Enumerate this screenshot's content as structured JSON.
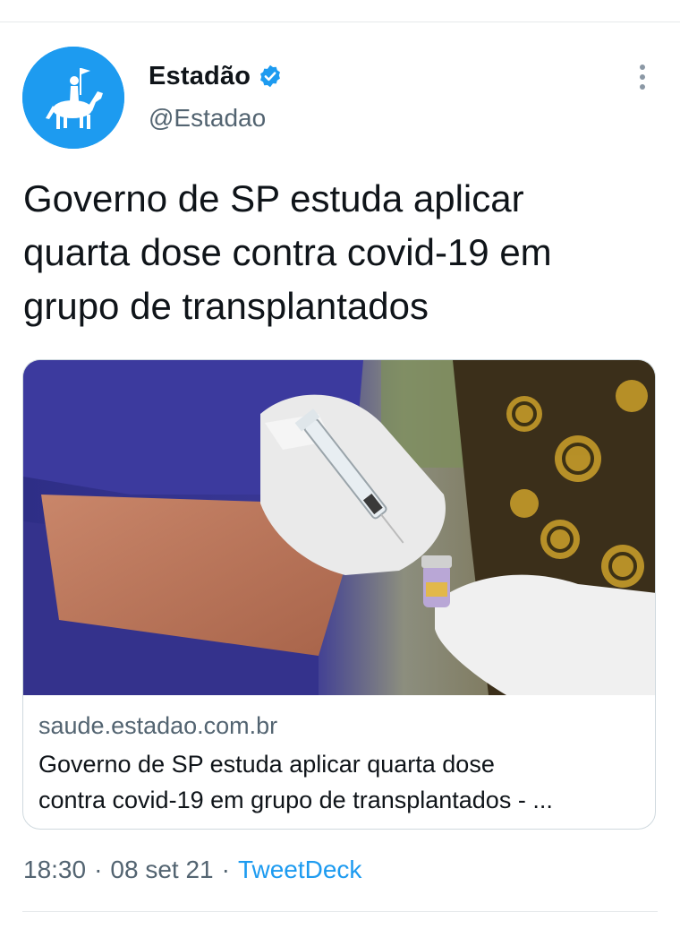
{
  "tweet": {
    "author": {
      "display_name": "Estadão",
      "handle": "@Estadao",
      "verified": true,
      "avatar_icon": "horse-rider-logo-icon",
      "avatar_color": "#1d9bf0"
    },
    "text_lines": [
      "Governo de SP estuda aplicar",
      "quarta dose contra covid-19 em",
      "grupo de transplantados"
    ],
    "link_card": {
      "image_icon": "vaccine-syringe-photo",
      "domain": "saude.estadao.com.br",
      "title_lines": [
        "Governo de SP estuda aplicar quarta dose",
        "contra covid-19 em grupo de transplantados - ..."
      ]
    },
    "meta": {
      "time": "18:30",
      "separator": "·",
      "date": "08 set 21",
      "source": "TweetDeck"
    }
  },
  "colors": {
    "accent": "#1d9bf0",
    "text_primary": "#0f1419",
    "text_secondary": "#536471",
    "border": "#cfd9de"
  },
  "icons": {
    "verified": "verified-badge-icon",
    "more": "more-vertical-icon"
  }
}
